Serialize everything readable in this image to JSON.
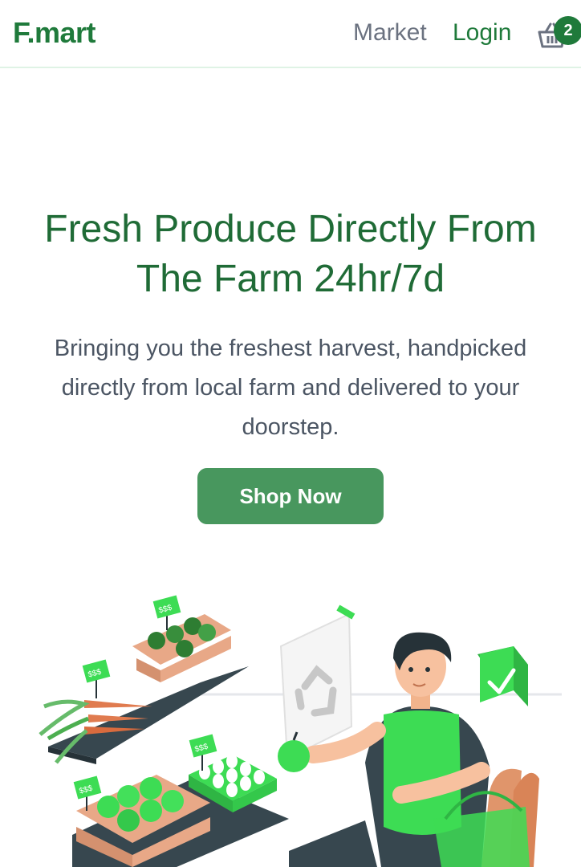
{
  "nav": {
    "brand": "F.mart",
    "market_label": "Market",
    "login_label": "Login",
    "cart_count": "2"
  },
  "hero": {
    "title": "Fresh Produce Directly From The Farm 24hr/7d",
    "subtitle": "Bringing you the freshest harvest, handpicked directly from local farm and delivered to your doorstep.",
    "cta_label": "Shop Now"
  },
  "illustration": {
    "price_tag": "$$$"
  },
  "colors": {
    "brand": "#1f7a3b",
    "button": "#48975e",
    "accent_green": "#3ddc54"
  }
}
